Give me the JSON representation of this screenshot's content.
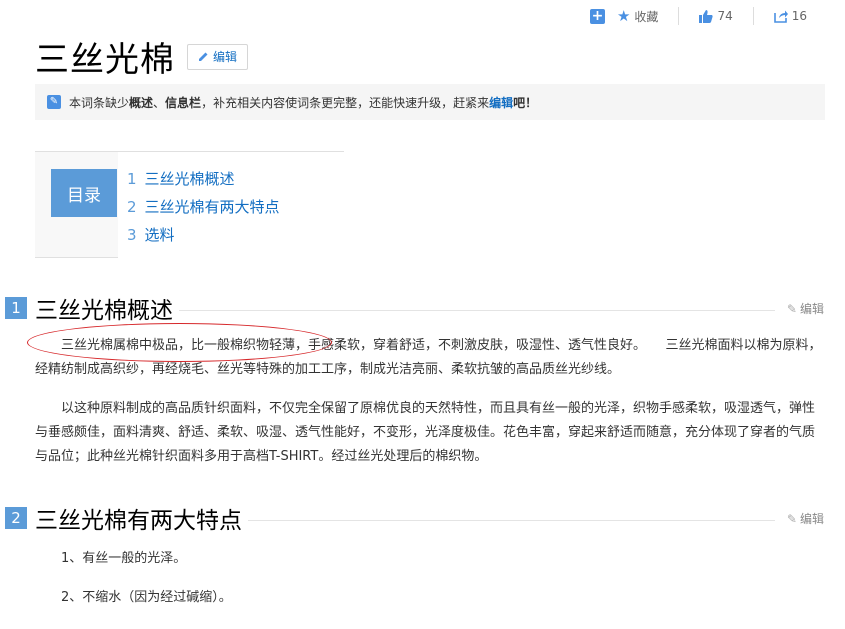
{
  "actions": {
    "favorite": "收藏",
    "like_count": "74",
    "share_count": "16"
  },
  "title": "三丝光棉",
  "edit_label": "编辑",
  "notice": {
    "prefix": "本词条缺少",
    "missing1": "概述",
    "sep": "、",
    "missing2": "信息栏",
    "mid": "，补充相关内容使词条更完整，还能快速升级，赶紧来",
    "link": "编辑",
    "suffix": "吧！"
  },
  "catalog": {
    "label": "目录",
    "items": [
      {
        "num": "1",
        "text": "三丝光棉概述"
      },
      {
        "num": "2",
        "text": "三丝光棉有两大特点"
      },
      {
        "num": "3",
        "text": "选料"
      }
    ]
  },
  "sections": [
    {
      "num": "1",
      "title": "三丝光棉概述",
      "edit": "编辑",
      "paragraphs": [
        "三丝光棉属棉中极品，比一般棉织物轻薄，手感柔软，穿着舒适，不刺激皮肤，吸湿性、透气性良好。　　三丝光棉面料以棉为原料，经精纺制成高织纱，再经烧毛、丝光等特殊的加工工序，制成光洁亮丽、柔软抗皱的高品质丝光纱线。",
        "以这种原料制成的高品质针织面料，不仅完全保留了原棉优良的天然特性，而且具有丝一般的光泽，织物手感柔软，吸湿透气，弹性与垂感颇佳，面料清爽、舒适、柔软、吸湿、透气性能好，不变形，光泽度极佳。花色丰富，穿起来舒适而随意，充分体现了穿者的气质与品位；此种丝光棉针织面料多用于高档T-SHIRT。经过丝光处理后的棉织物。"
      ]
    },
    {
      "num": "2",
      "title": "三丝光棉有两大特点",
      "edit": "编辑",
      "items": [
        "1、有丝一般的光泽。",
        "2、不缩水（因为经过碱缩）。"
      ]
    }
  ]
}
